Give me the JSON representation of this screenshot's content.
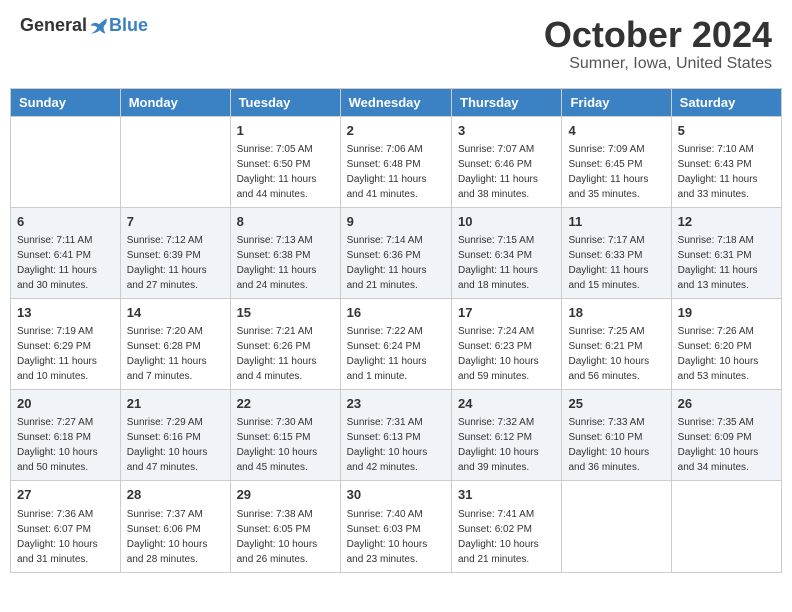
{
  "header": {
    "logo_general": "General",
    "logo_blue": "Blue",
    "month_title": "October 2024",
    "subtitle": "Sumner, Iowa, United States"
  },
  "weekdays": [
    "Sunday",
    "Monday",
    "Tuesday",
    "Wednesday",
    "Thursday",
    "Friday",
    "Saturday"
  ],
  "weeks": [
    [
      {
        "day": "",
        "sunrise": "",
        "sunset": "",
        "daylight": ""
      },
      {
        "day": "",
        "sunrise": "",
        "sunset": "",
        "daylight": ""
      },
      {
        "day": "1",
        "sunrise": "Sunrise: 7:05 AM",
        "sunset": "Sunset: 6:50 PM",
        "daylight": "Daylight: 11 hours and 44 minutes."
      },
      {
        "day": "2",
        "sunrise": "Sunrise: 7:06 AM",
        "sunset": "Sunset: 6:48 PM",
        "daylight": "Daylight: 11 hours and 41 minutes."
      },
      {
        "day": "3",
        "sunrise": "Sunrise: 7:07 AM",
        "sunset": "Sunset: 6:46 PM",
        "daylight": "Daylight: 11 hours and 38 minutes."
      },
      {
        "day": "4",
        "sunrise": "Sunrise: 7:09 AM",
        "sunset": "Sunset: 6:45 PM",
        "daylight": "Daylight: 11 hours and 35 minutes."
      },
      {
        "day": "5",
        "sunrise": "Sunrise: 7:10 AM",
        "sunset": "Sunset: 6:43 PM",
        "daylight": "Daylight: 11 hours and 33 minutes."
      }
    ],
    [
      {
        "day": "6",
        "sunrise": "Sunrise: 7:11 AM",
        "sunset": "Sunset: 6:41 PM",
        "daylight": "Daylight: 11 hours and 30 minutes."
      },
      {
        "day": "7",
        "sunrise": "Sunrise: 7:12 AM",
        "sunset": "Sunset: 6:39 PM",
        "daylight": "Daylight: 11 hours and 27 minutes."
      },
      {
        "day": "8",
        "sunrise": "Sunrise: 7:13 AM",
        "sunset": "Sunset: 6:38 PM",
        "daylight": "Daylight: 11 hours and 24 minutes."
      },
      {
        "day": "9",
        "sunrise": "Sunrise: 7:14 AM",
        "sunset": "Sunset: 6:36 PM",
        "daylight": "Daylight: 11 hours and 21 minutes."
      },
      {
        "day": "10",
        "sunrise": "Sunrise: 7:15 AM",
        "sunset": "Sunset: 6:34 PM",
        "daylight": "Daylight: 11 hours and 18 minutes."
      },
      {
        "day": "11",
        "sunrise": "Sunrise: 7:17 AM",
        "sunset": "Sunset: 6:33 PM",
        "daylight": "Daylight: 11 hours and 15 minutes."
      },
      {
        "day": "12",
        "sunrise": "Sunrise: 7:18 AM",
        "sunset": "Sunset: 6:31 PM",
        "daylight": "Daylight: 11 hours and 13 minutes."
      }
    ],
    [
      {
        "day": "13",
        "sunrise": "Sunrise: 7:19 AM",
        "sunset": "Sunset: 6:29 PM",
        "daylight": "Daylight: 11 hours and 10 minutes."
      },
      {
        "day": "14",
        "sunrise": "Sunrise: 7:20 AM",
        "sunset": "Sunset: 6:28 PM",
        "daylight": "Daylight: 11 hours and 7 minutes."
      },
      {
        "day": "15",
        "sunrise": "Sunrise: 7:21 AM",
        "sunset": "Sunset: 6:26 PM",
        "daylight": "Daylight: 11 hours and 4 minutes."
      },
      {
        "day": "16",
        "sunrise": "Sunrise: 7:22 AM",
        "sunset": "Sunset: 6:24 PM",
        "daylight": "Daylight: 11 hours and 1 minute."
      },
      {
        "day": "17",
        "sunrise": "Sunrise: 7:24 AM",
        "sunset": "Sunset: 6:23 PM",
        "daylight": "Daylight: 10 hours and 59 minutes."
      },
      {
        "day": "18",
        "sunrise": "Sunrise: 7:25 AM",
        "sunset": "Sunset: 6:21 PM",
        "daylight": "Daylight: 10 hours and 56 minutes."
      },
      {
        "day": "19",
        "sunrise": "Sunrise: 7:26 AM",
        "sunset": "Sunset: 6:20 PM",
        "daylight": "Daylight: 10 hours and 53 minutes."
      }
    ],
    [
      {
        "day": "20",
        "sunrise": "Sunrise: 7:27 AM",
        "sunset": "Sunset: 6:18 PM",
        "daylight": "Daylight: 10 hours and 50 minutes."
      },
      {
        "day": "21",
        "sunrise": "Sunrise: 7:29 AM",
        "sunset": "Sunset: 6:16 PM",
        "daylight": "Daylight: 10 hours and 47 minutes."
      },
      {
        "day": "22",
        "sunrise": "Sunrise: 7:30 AM",
        "sunset": "Sunset: 6:15 PM",
        "daylight": "Daylight: 10 hours and 45 minutes."
      },
      {
        "day": "23",
        "sunrise": "Sunrise: 7:31 AM",
        "sunset": "Sunset: 6:13 PM",
        "daylight": "Daylight: 10 hours and 42 minutes."
      },
      {
        "day": "24",
        "sunrise": "Sunrise: 7:32 AM",
        "sunset": "Sunset: 6:12 PM",
        "daylight": "Daylight: 10 hours and 39 minutes."
      },
      {
        "day": "25",
        "sunrise": "Sunrise: 7:33 AM",
        "sunset": "Sunset: 6:10 PM",
        "daylight": "Daylight: 10 hours and 36 minutes."
      },
      {
        "day": "26",
        "sunrise": "Sunrise: 7:35 AM",
        "sunset": "Sunset: 6:09 PM",
        "daylight": "Daylight: 10 hours and 34 minutes."
      }
    ],
    [
      {
        "day": "27",
        "sunrise": "Sunrise: 7:36 AM",
        "sunset": "Sunset: 6:07 PM",
        "daylight": "Daylight: 10 hours and 31 minutes."
      },
      {
        "day": "28",
        "sunrise": "Sunrise: 7:37 AM",
        "sunset": "Sunset: 6:06 PM",
        "daylight": "Daylight: 10 hours and 28 minutes."
      },
      {
        "day": "29",
        "sunrise": "Sunrise: 7:38 AM",
        "sunset": "Sunset: 6:05 PM",
        "daylight": "Daylight: 10 hours and 26 minutes."
      },
      {
        "day": "30",
        "sunrise": "Sunrise: 7:40 AM",
        "sunset": "Sunset: 6:03 PM",
        "daylight": "Daylight: 10 hours and 23 minutes."
      },
      {
        "day": "31",
        "sunrise": "Sunrise: 7:41 AM",
        "sunset": "Sunset: 6:02 PM",
        "daylight": "Daylight: 10 hours and 21 minutes."
      },
      {
        "day": "",
        "sunrise": "",
        "sunset": "",
        "daylight": ""
      },
      {
        "day": "",
        "sunrise": "",
        "sunset": "",
        "daylight": ""
      }
    ]
  ]
}
